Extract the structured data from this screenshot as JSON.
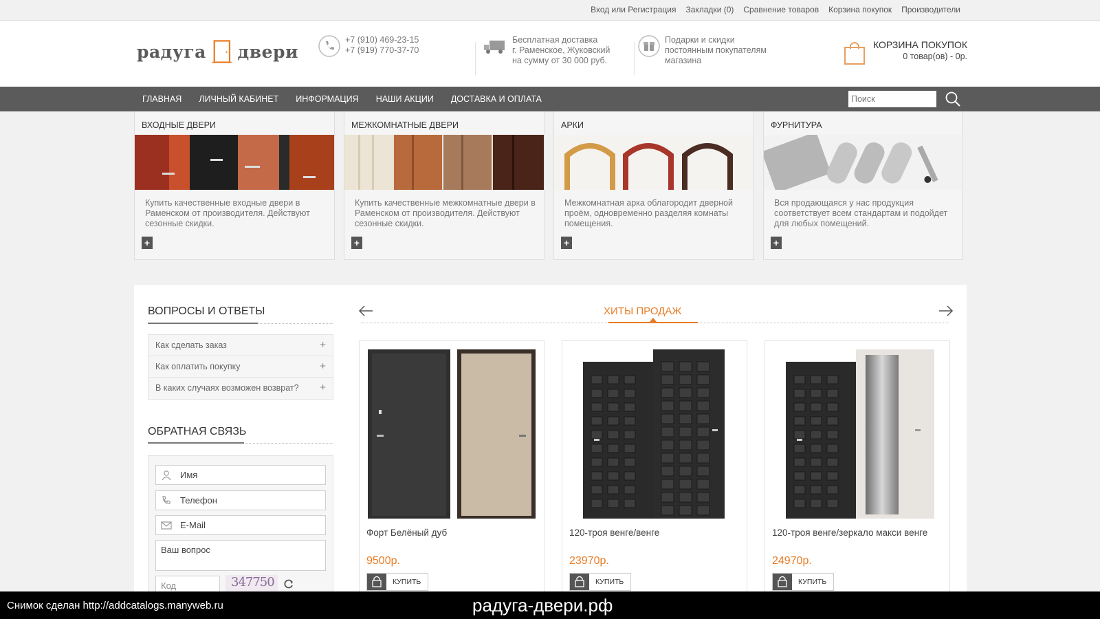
{
  "toplinks": [
    "Вход или Регистрация",
    "Закладки (0)",
    "Сравнение товаров",
    "Корзина покупок",
    "Производители"
  ],
  "logo": {
    "left": "радуга",
    "right": "двери"
  },
  "phones": [
    "+7 (910) 469-23-15",
    "+7 (919) 770-37-70"
  ],
  "delivery": [
    "Бесплатная доставка",
    "г. Раменское, Жуковский",
    "на сумму от 30 000 руб."
  ],
  "gifts": [
    "Подарки и скидки",
    "постоянным покупателям",
    "магазина"
  ],
  "cart": {
    "title": "КОРЗИНА ПОКУПОК",
    "summary": "0 товар(ов) - 0р."
  },
  "nav": [
    "ГЛАВНАЯ",
    "ЛИЧНЫЙ КАБИНЕТ",
    "ИНФОРМАЦИЯ",
    "НАШИ АКЦИИ",
    "ДОСТАВКА И ОПЛАТА"
  ],
  "search": {
    "placeholder": "Поиск"
  },
  "categories": [
    {
      "title": "ВХОДНЫЕ ДВЕРИ",
      "desc": "Купить качественные входные двери в Раменском от производителя. Действуют сезонные скидки."
    },
    {
      "title": "МЕЖКОМНАТНЫЕ ДВЕРИ",
      "desc": "Купить качественные межкомнатные двери в Раменском от производителя. Действуют сезонные скидки."
    },
    {
      "title": "АРКИ",
      "desc": "Межкомнатная арка облагородит дверной проём, одновременно разделяя комнаты помещения."
    },
    {
      "title": "ФУРНИТУРА",
      "desc": "Вся продающаяся у нас продукция соответствует всем стандартам и подойдет для любых помещений."
    }
  ],
  "plus_label": "+",
  "faq": {
    "title": "ВОПРОСЫ И ОТВЕТЫ",
    "items": [
      "Как сделать заказ",
      "Как оплатить покупку",
      "В каких случаях возможен возврат?"
    ],
    "expand": "+"
  },
  "feedback": {
    "title": "ОБРАТНАЯ СВЯЗЬ",
    "name": "Имя",
    "phone": "Телефон",
    "email": "E-Mail",
    "question": "Ваш вопрос",
    "code": "Код",
    "captcha": "347750"
  },
  "hits": {
    "title": "ХИТЫ ПРОДАЖ",
    "products": [
      {
        "name": "Форт Белёный дуб",
        "price": "9500р.",
        "buy": "КУПИТЬ"
      },
      {
        "name": "120-троя венге/венге",
        "price": "23970р.",
        "buy": "КУПИТЬ"
      },
      {
        "name": "120-троя венге/зеркало макси венге",
        "price": "24970р.",
        "buy": "КУПИТЬ"
      }
    ]
  },
  "footer": {
    "note": "Снимок сделан http://addcatalogs.manyweb.ru",
    "site": "радуга-двери.рф"
  },
  "colors": {
    "accent": "#e87b24",
    "nav": "#5b5b5b",
    "background": "#f1f1f1"
  }
}
